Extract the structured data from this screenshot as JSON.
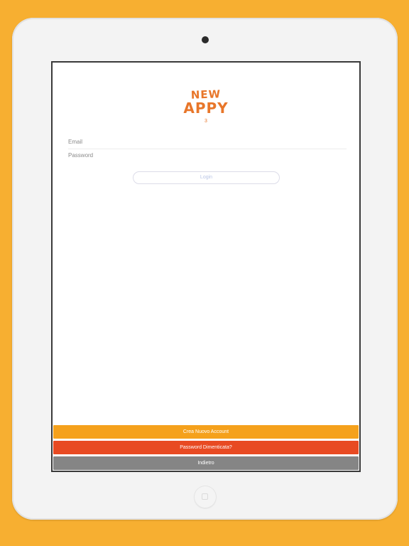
{
  "logo": {
    "line1": "NEW",
    "line2": "APPY",
    "brand_color": "#e8762a"
  },
  "version": "3",
  "login_form": {
    "email_placeholder": "Email",
    "password_placeholder": "Password",
    "login_label": "Login"
  },
  "actions": {
    "create_account_label": "Crea Nuovo Account",
    "forgot_password_label": "Password Dimenticata?",
    "back_label": "Indietro"
  },
  "colors": {
    "frame_background": "#f7af31",
    "create_account": "#f5a11c",
    "forgot_password": "#e84a22",
    "back": "#858585"
  }
}
